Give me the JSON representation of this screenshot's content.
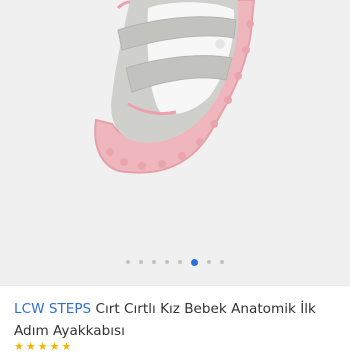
{
  "gallery": {
    "image_alt_icon": "shoe-product-image",
    "slide_count": 8,
    "active_index": 5,
    "accent_color": "#2b6fde"
  },
  "product": {
    "brand": "LCW STEPS",
    "title": "Cırt Cırtlı Kız Bebek Anatomik İlk Adım Ayakkabısı",
    "rating": {
      "value": 5,
      "max": 5,
      "count_text": ""
    },
    "brand_color": "#2d6fd6"
  }
}
